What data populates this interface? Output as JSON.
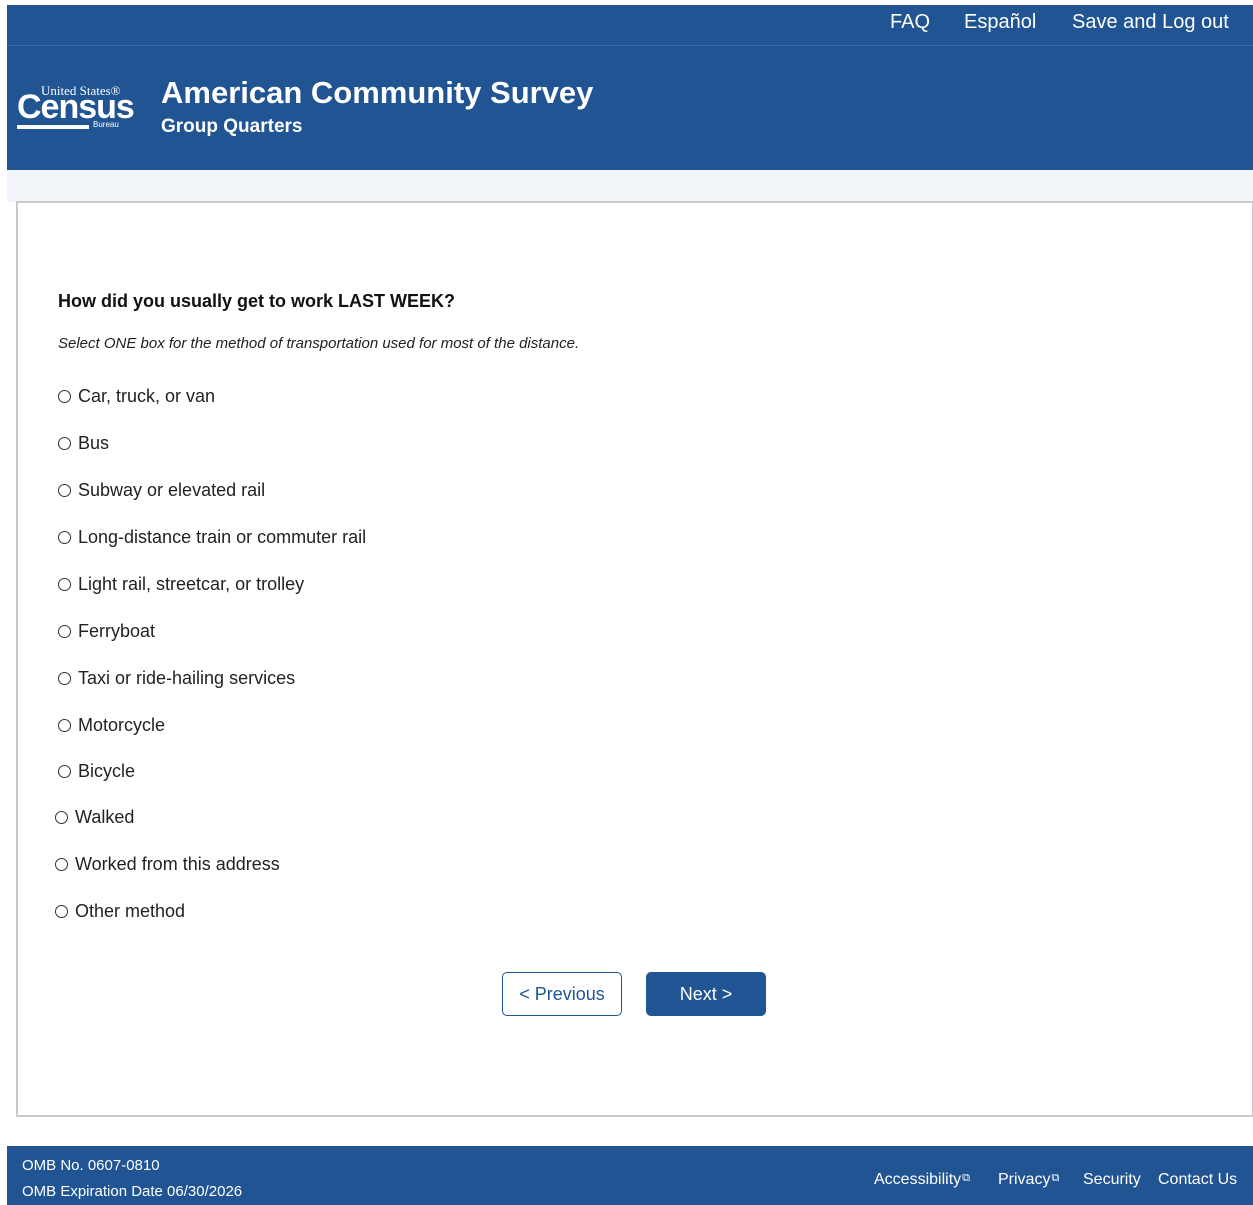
{
  "header": {
    "nav": {
      "faq": "FAQ",
      "espanol": "Español",
      "save_logout": "Save and Log out"
    },
    "logo": {
      "line1": "United States®",
      "line2": "Census",
      "line3": "Bureau"
    },
    "title": "American Community Survey",
    "subtitle": "Group Quarters"
  },
  "form": {
    "question": "How did you usually get to work LAST WEEK?",
    "instruction": "Select ONE box for the method of transportation used for most of the distance.",
    "options": [
      "Car, truck, or van",
      "Bus",
      "Subway or elevated rail",
      "Long-distance train or commuter rail",
      "Light rail, streetcar, or trolley",
      "Ferryboat",
      "Taxi or ride-hailing services",
      "Motorcycle",
      "Bicycle",
      "Walked",
      "Worked from this address",
      "Other method"
    ],
    "previous_label": "< Previous",
    "next_label": "Next >"
  },
  "footer": {
    "omb_number": "OMB No. 0607-0810",
    "omb_expiration": "OMB Expiration Date 06/30/2026",
    "links": {
      "accessibility": "Accessibility",
      "privacy": "Privacy",
      "security": "Security",
      "contact": "Contact Us"
    },
    "external_icon": "external-link-icon"
  },
  "colors": {
    "brand_blue": "#205493",
    "card_border": "#c7c9cc",
    "band": "#f1f4f9"
  }
}
